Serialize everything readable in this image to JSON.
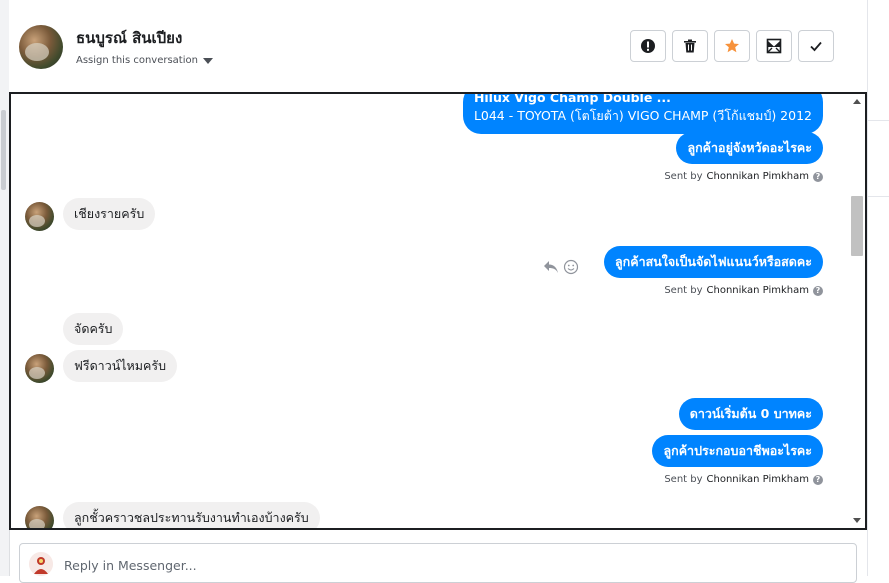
{
  "header": {
    "contact_name": "ธนบูรณ์ สินเปียง",
    "assign_label": "Assign this conversation",
    "actions": {
      "spam": "spam-icon",
      "delete": "trash-icon",
      "star": "star-icon",
      "unread": "mark-unread-icon",
      "done": "checkmark-icon"
    },
    "colors": {
      "star": "#f7923b",
      "icon": "#1c1e21"
    }
  },
  "messages": {
    "m1_line1": "Hilux Vigo Champ Double  ...",
    "m1_line2": "L044 - TOYOTA (โตโยต้า) VIGO CHAMP (วีโก้แชมป์) 2012",
    "m2": "ลูกค้าอยู่จังหวัดอะไรคะ",
    "m3": "เชียงรายครับ",
    "m4": "ลูกค้าสนใจเป็นจัดไฟแนนว์หรือสดคะ",
    "m5": "จัดครับ",
    "m6": "ฟรีดาวน์ไหมครับ",
    "m7": "ดาวน์เริ่มต้น 0 บาทคะ",
    "m8": "ลูกค้าประกอบอาชีพอะไรคะ",
    "m9": "ลูกชั้วคราวชลประทานรับงานทำเองบ้างครับ"
  },
  "sent_by": {
    "prefix": "Sent by",
    "name": "Chonnikan Pimkham",
    "help": "?"
  },
  "message_actions": {
    "reply": "reply-icon",
    "react": "smiley-icon"
  },
  "reply": {
    "placeholder": "Reply in Messenger..."
  },
  "colors": {
    "outgoing": "#0084ff",
    "incoming": "#f1f0f0"
  }
}
